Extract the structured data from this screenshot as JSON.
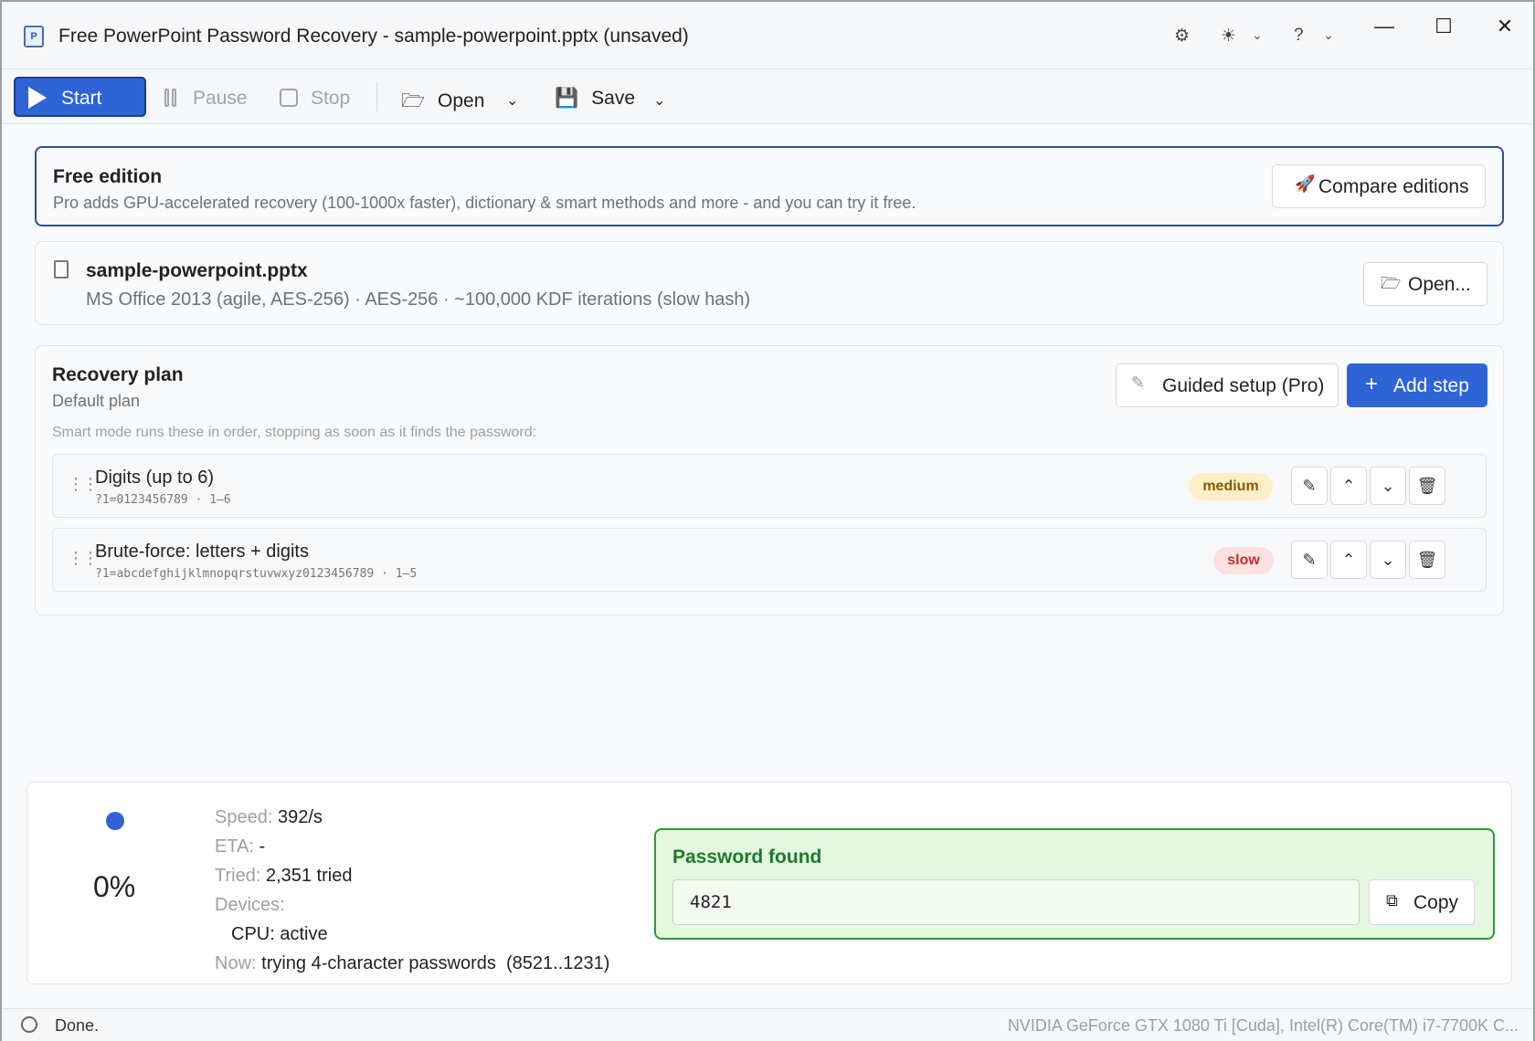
{
  "window": {
    "title": "Free PowerPoint Password Recovery - sample-powerpoint.pptx (unsaved)",
    "app_icon_letter": "P",
    "icons": [
      "gear-icon",
      "sun-icon",
      "help-icon"
    ],
    "controls": {
      "minimize": "—",
      "maximize": "☐",
      "close": "✕"
    }
  },
  "toolbar": {
    "start_label": "Start",
    "pause_label": "Pause",
    "stop_label": "Stop",
    "open_label": "Open",
    "save_label": "Save"
  },
  "banner": {
    "title": "Free edition",
    "description": "Pro adds GPU-accelerated recovery (100-1000x faster), dictionary & smart methods and more - and you can try it free.",
    "compare_label": "Compare editions"
  },
  "file": {
    "name": "sample-powerpoint.pptx",
    "description": "MS Office 2013 (agile, AES-256) · AES-256 · ~100,000 KDF iterations (slow hash)",
    "open_label": "Open..."
  },
  "plan": {
    "title": "Recovery plan",
    "subtitle": "Default plan",
    "note": "Smart mode runs these in order, stopping as soon as it finds the password:",
    "guided_label": "Guided setup (Pro)",
    "add_label": "Add step",
    "steps": [
      {
        "name": "Digits (up to 6)",
        "mask": "?1=0123456789 · 1–6",
        "speed": "medium"
      },
      {
        "name": "Brute-force: letters + digits",
        "mask": "?1=abcdefghijklmnopqrstuvwxyz0123456789 · 1–5",
        "speed": "slow"
      }
    ]
  },
  "progress": {
    "percent": "0%",
    "speed_key": "Speed:",
    "speed": "392/s",
    "eta_key": "ETA:",
    "eta": "-",
    "tried_key": "Tried:",
    "tried": "2,351 tried",
    "devices_key": "Devices:",
    "device_cpu": "CPU: active",
    "now_key": "Now:",
    "now": "trying 4-character passwords  (8521..1231)"
  },
  "found": {
    "title": "Password found",
    "password": "4821",
    "copy_label": "Copy"
  },
  "status": {
    "text": "Done.",
    "devices": "NVIDIA GeForce GTX 1080 Ti [Cuda], Intel(R) Core(TM) i7-7700K C..."
  },
  "colors": {
    "accent": "#2f64d6",
    "success": "#2c9a35",
    "medium_badge": "#fcefc7",
    "slow_badge": "#fbe1e1"
  }
}
